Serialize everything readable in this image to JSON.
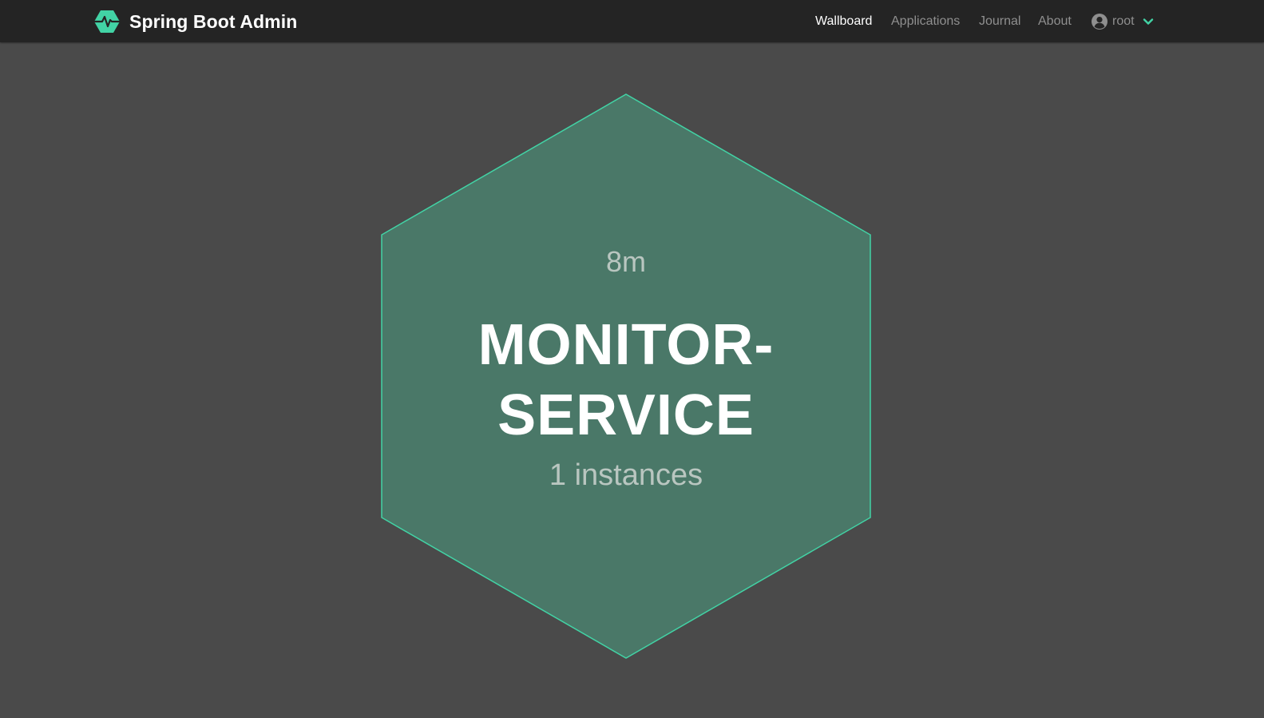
{
  "app": {
    "title": "Spring Boot Admin"
  },
  "nav": {
    "items": [
      {
        "label": "Wallboard",
        "active": true
      },
      {
        "label": "Applications",
        "active": false
      },
      {
        "label": "Journal",
        "active": false
      },
      {
        "label": "About",
        "active": false
      }
    ],
    "user": {
      "name": "root",
      "icon": "user-circle-icon",
      "dropdown_icon": "chevron-down-icon"
    }
  },
  "wallboard": {
    "applications": [
      {
        "time": "8m",
        "name_line1": "MONITOR-",
        "name_line2": "SERVICE",
        "instances": "1 instances",
        "status_color": "#42d3a5"
      }
    ]
  },
  "colors": {
    "navbar": "#242424",
    "background": "#4a4a4a",
    "accent": "#42d3a5",
    "hex_fill": "#4a7868"
  }
}
